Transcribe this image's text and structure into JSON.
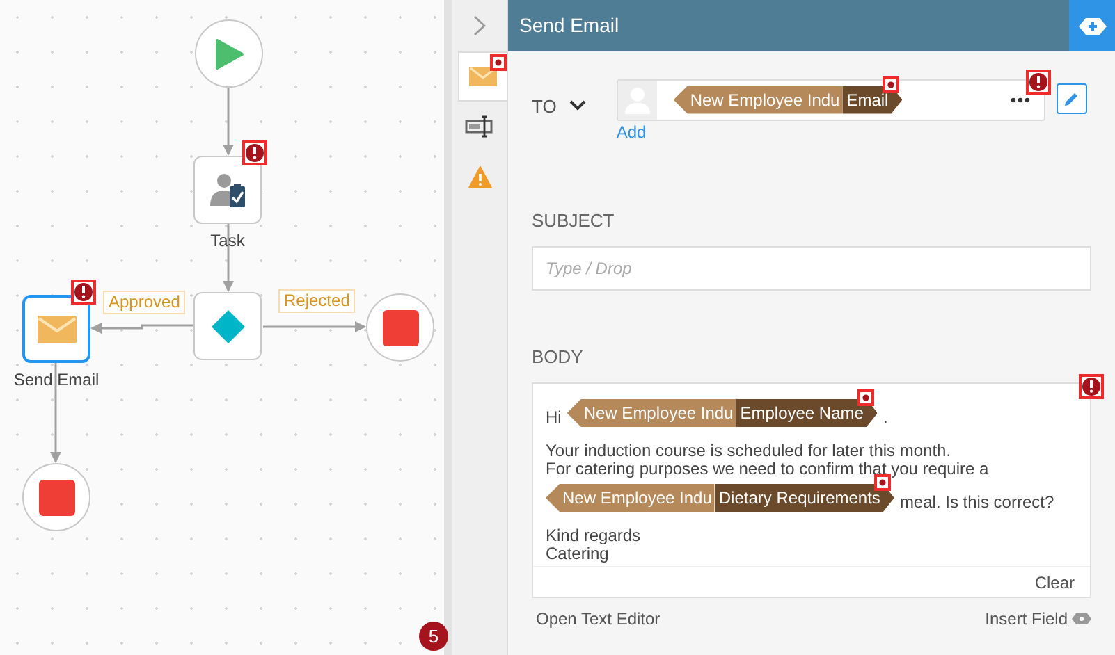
{
  "diagram": {
    "nodes": [
      {
        "kind": "start",
        "selected": false
      },
      {
        "kind": "task",
        "label": "Task",
        "selected": false,
        "error": true
      },
      {
        "kind": "gateway",
        "selected": false
      },
      {
        "kind": "email",
        "label": "Send Email",
        "selected": true,
        "error": true
      },
      {
        "kind": "end",
        "selected": false
      },
      {
        "kind": "end",
        "selected": false
      }
    ],
    "edge_labels": [
      "Approved",
      "Rejected"
    ],
    "error_count": "5"
  },
  "panel": {
    "title": "Send Email",
    "side_tabs": [
      {
        "kind": "email",
        "selected": true,
        "flag": true
      },
      {
        "kind": "form",
        "selected": false
      },
      {
        "kind": "warning",
        "selected": false
      }
    ],
    "to": {
      "label": "TO",
      "token": {
        "source": "New Employee Indu",
        "field": "Email",
        "flag": true
      },
      "add": "Add",
      "error": true
    },
    "subject": {
      "label": "SUBJECT",
      "placeholder": "Type / Drop"
    },
    "body": {
      "label": "BODY",
      "error": true,
      "lines": [
        {
          "kind": "line",
          "segments": [
            {
              "kind": "text",
              "text": "Hi"
            },
            {
              "kind": "token",
              "source": "New Employee Indu",
              "field": "Employee Name",
              "flag": true
            },
            {
              "kind": "text",
              "text": "."
            }
          ]
        },
        {
          "kind": "gap"
        },
        {
          "kind": "line",
          "segments": [
            {
              "kind": "text",
              "text": "Your induction course is scheduled for later this month."
            }
          ]
        },
        {
          "kind": "line",
          "segments": [
            {
              "kind": "text",
              "text": "For catering purposes we need to confirm that you require a"
            }
          ]
        },
        {
          "kind": "line",
          "segments": [
            {
              "kind": "token",
              "source": "New Employee Indu",
              "field": "Dietary Requirements",
              "flag": true
            },
            {
              "kind": "text",
              "text": "meal. Is this correct?"
            }
          ]
        },
        {
          "kind": "gap"
        },
        {
          "kind": "line",
          "segments": [
            {
              "kind": "text",
              "text": "Kind regards"
            }
          ]
        },
        {
          "kind": "line",
          "segments": [
            {
              "kind": "text",
              "text": "Catering"
            }
          ]
        }
      ],
      "clear": "Clear"
    },
    "open_editor": "Open Text Editor",
    "insert_field": "Insert Field"
  }
}
